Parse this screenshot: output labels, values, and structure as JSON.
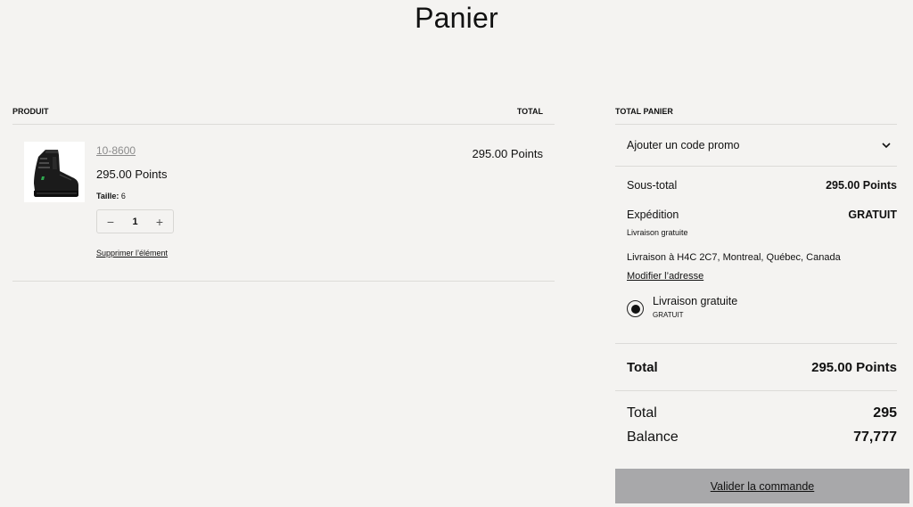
{
  "page": {
    "title": "Panier"
  },
  "cart": {
    "headers": {
      "product": "Produit",
      "total": "Total"
    },
    "items": [
      {
        "sku": "10-8600",
        "price": "295.00 Points",
        "size_label": "Taille:",
        "size_value": "6",
        "quantity": "1",
        "qty_minus": "−",
        "qty_plus": "+",
        "remove_label": "Supprimer l’élément",
        "line_total": "295.00 Points",
        "image_icon": "black-work-boot"
      }
    ]
  },
  "totals": {
    "header": "Total panier",
    "promo_label": "Ajouter un code promo",
    "subtotal_label": "Sous-total",
    "subtotal_value": "295.00 Points",
    "shipping_label": "Expédition",
    "shipping_value": "GRATUIT",
    "shipping_note": "Livraison gratuite",
    "shipping_address": "Livraison à H4C 2C7, Montreal, Québec, Canada",
    "edit_address_label": "Modifier l’adresse",
    "shipping_option_label": "Livraison gratuite",
    "shipping_option_price": "GRATUIT",
    "grand_total_label": "Total",
    "grand_total_value": "295.00 Points",
    "points_total_label": "Total",
    "points_total_value": "295",
    "balance_label": "Balance",
    "balance_value": "77,777"
  },
  "checkout": {
    "label": "Valider la commande"
  },
  "colors": {
    "background": "#f4f3f1",
    "button": "#a8a8aa",
    "divider": "#dcdbd8"
  }
}
